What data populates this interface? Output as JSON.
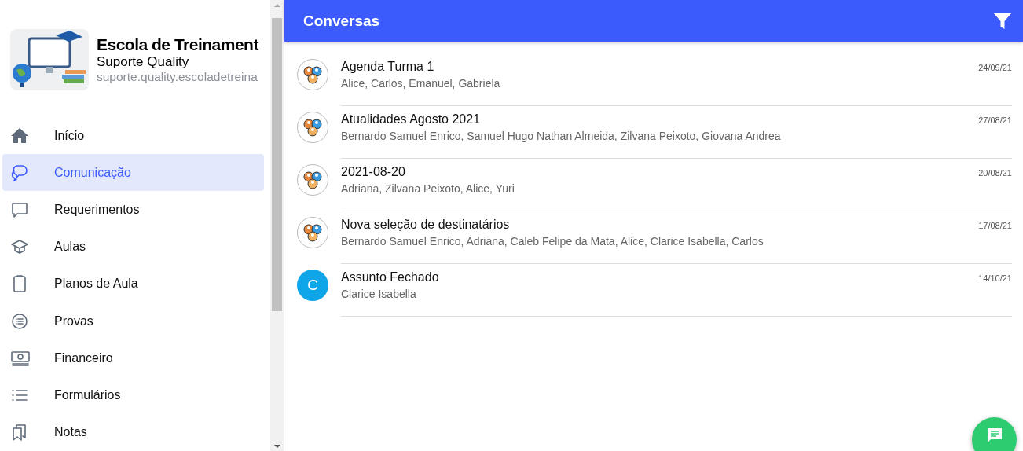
{
  "sidebar": {
    "school": {
      "name": "Escola de Treinament",
      "account": "Suporte Quality",
      "domain": "suporte.quality.escoladetreina"
    },
    "items": [
      {
        "label": "Início",
        "selected": false
      },
      {
        "label": "Comunicação",
        "selected": true
      },
      {
        "label": "Requerimentos",
        "selected": false
      },
      {
        "label": "Aulas",
        "selected": false
      },
      {
        "label": "Planos de Aula",
        "selected": false
      },
      {
        "label": "Provas",
        "selected": false
      },
      {
        "label": "Financeiro",
        "selected": false
      },
      {
        "label": "Formulários",
        "selected": false
      },
      {
        "label": "Notas",
        "selected": false
      }
    ]
  },
  "header": {
    "title": "Conversas"
  },
  "conversations": [
    {
      "title": "Agenda Turma 1",
      "members": "Alice, Carlos, Emanuel, Gabriela",
      "date": "24/09/21",
      "avatar": {
        "kind": "group"
      }
    },
    {
      "title": "Atualidades Agosto 2021",
      "members": "Bernardo Samuel Enrico, Samuel Hugo Nathan Almeida, Zilvana Peixoto, Giovana Andrea",
      "date": "27/08/21",
      "avatar": {
        "kind": "group"
      }
    },
    {
      "title": "2021-08-20",
      "members": "Adriana, Zilvana Peixoto, Alice, Yuri",
      "date": "20/08/21",
      "avatar": {
        "kind": "group"
      }
    },
    {
      "title": "Nova seleção de destinatários",
      "members": "Bernardo Samuel Enrico, Adriana, Caleb Felipe da Mata, Alice, Clarice Isabella, Carlos",
      "date": "17/08/21",
      "avatar": {
        "kind": "group"
      }
    },
    {
      "title": "Assunto Fechado",
      "members": "Clarice Isabella",
      "date": "14/10/21",
      "avatar": {
        "kind": "letter",
        "letter": "C",
        "color": "#0ea5e9"
      }
    }
  ]
}
